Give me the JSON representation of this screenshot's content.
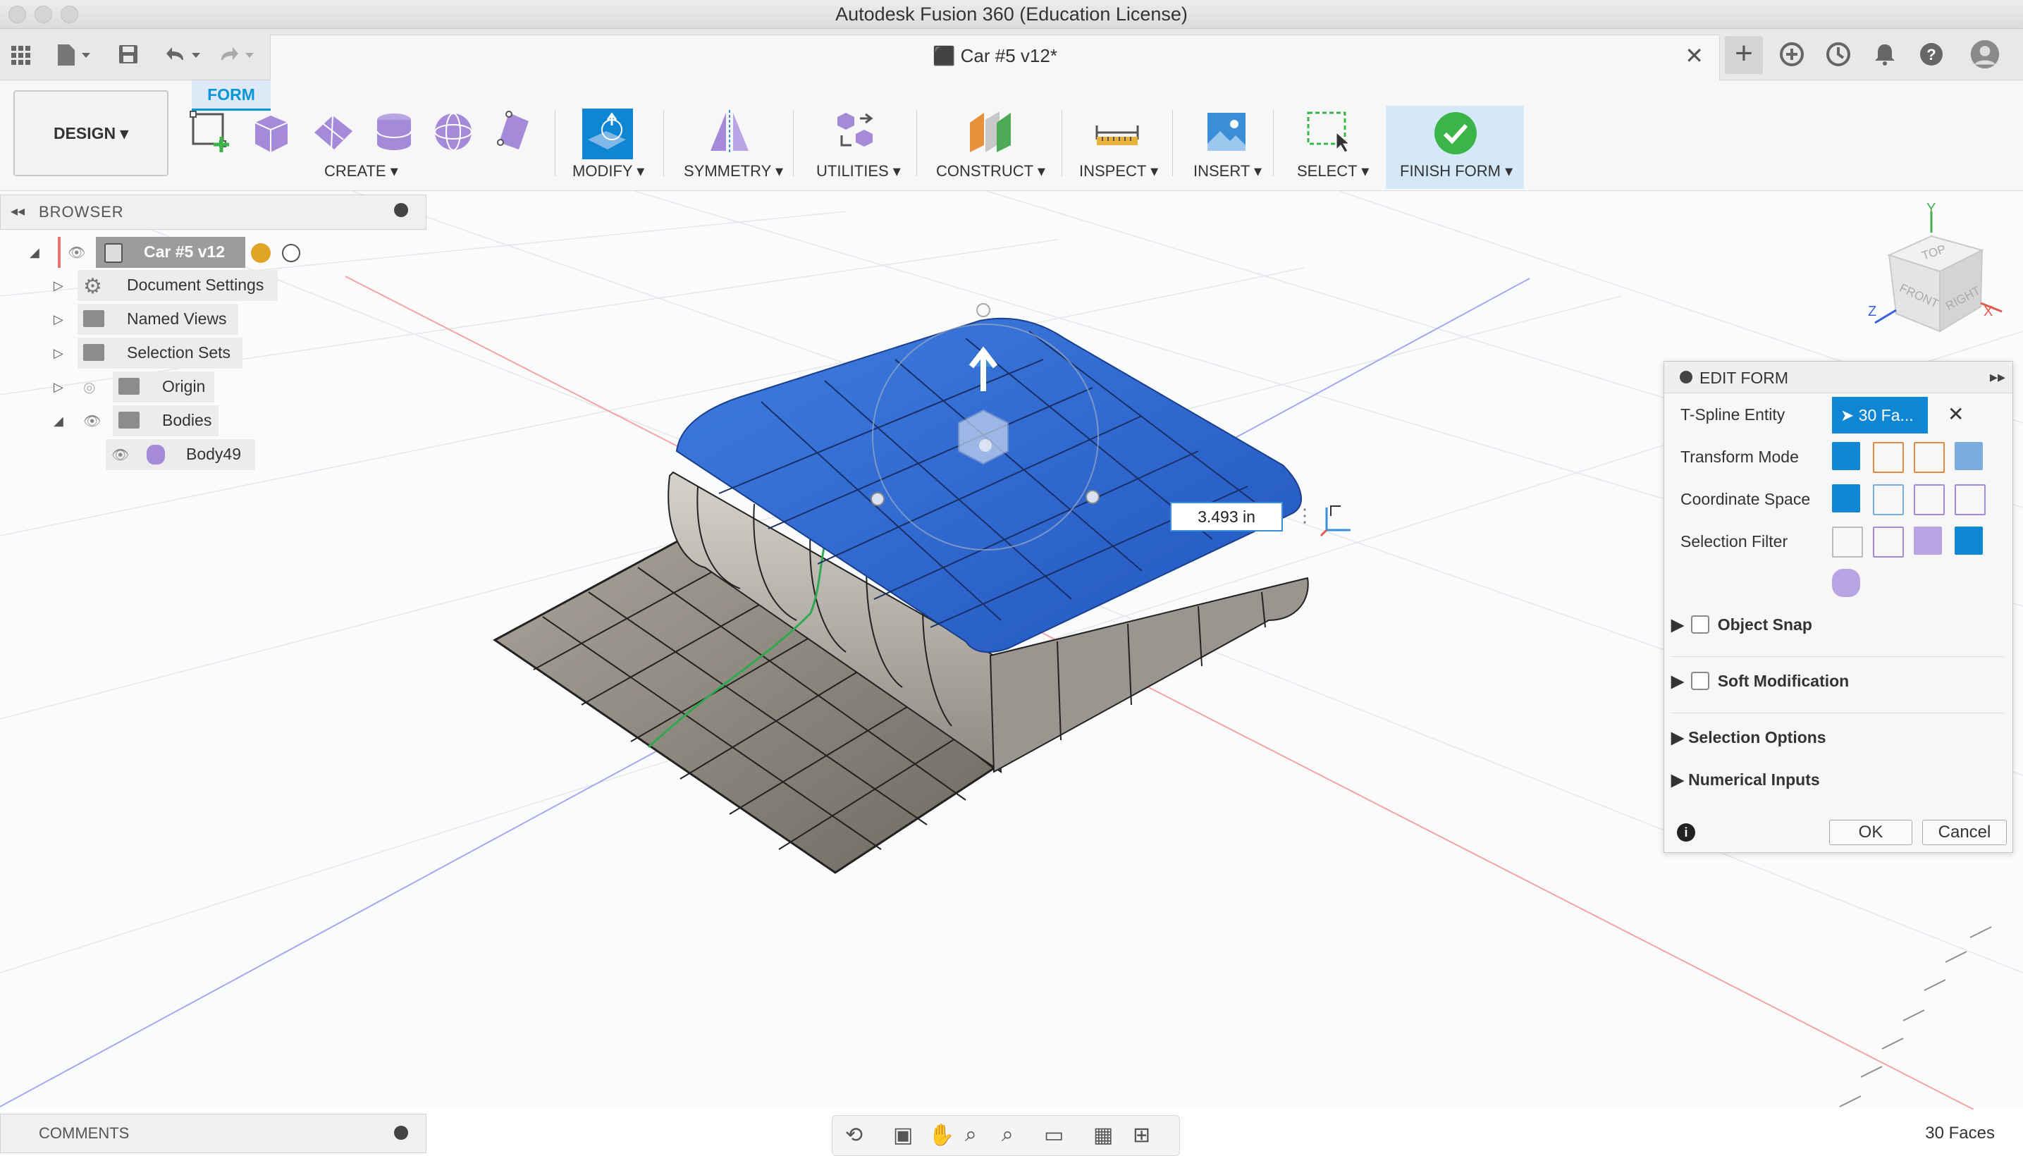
{
  "window": {
    "title": "Autodesk Fusion 360 (Education License)"
  },
  "tabbar": {
    "doc_tab_label": "Car #5 v12*",
    "close_glyph": "✕",
    "new_tab_glyph": "+",
    "icons": [
      "app-grid-icon",
      "file-icon",
      "save-icon",
      "undo-icon",
      "redo-icon",
      "extensions-icon",
      "job-status-icon",
      "notifications-icon",
      "help-icon",
      "profile-icon"
    ]
  },
  "toolbar": {
    "workspace_label": "DESIGN ▾",
    "active_tab": "FORM",
    "groups": {
      "create": "CREATE ▾",
      "modify": "MODIFY ▾",
      "symmetry": "SYMMETRY ▾",
      "utilities": "UTILITIES ▾",
      "construct": "CONSTRUCT ▾",
      "inspect": "INSPECT ▾",
      "insert": "INSERT ▾",
      "select": "SELECT ▾",
      "finish": "FINISH FORM ▾"
    }
  },
  "browser": {
    "title": "BROWSER",
    "root": "Car #5 v12",
    "items": [
      "Document Settings",
      "Named Views",
      "Selection Sets",
      "Origin",
      "Bodies",
      "Body49"
    ]
  },
  "viewport": {
    "dimension_value": "3.493 in",
    "viewcube": {
      "top": "TOP",
      "front": "FRONT",
      "right": "RIGHT",
      "axis_x": "X",
      "axis_y": "Y",
      "axis_z": "Z"
    }
  },
  "edit_form": {
    "title": "EDIT FORM",
    "tspline_label": "T-Spline Entity",
    "tspline_value": "30 Fa...",
    "transform_mode": "Transform Mode",
    "coordinate_space": "Coordinate Space",
    "selection_filter": "Selection Filter",
    "object_snap": "Object Snap",
    "soft_modification": "Soft Modification",
    "selection_options": "Selection Options",
    "numerical_inputs": "Numerical Inputs",
    "ok": "OK",
    "cancel": "Cancel",
    "accent_color": "#0e86d4"
  },
  "comments": {
    "title": "COMMENTS"
  },
  "status": {
    "faces": "30 Faces"
  },
  "colors": {
    "selected_faces": "#2f6ccf",
    "body": "#a8a49c",
    "accent": "#0696d7",
    "finish_check": "#3bb54a"
  }
}
